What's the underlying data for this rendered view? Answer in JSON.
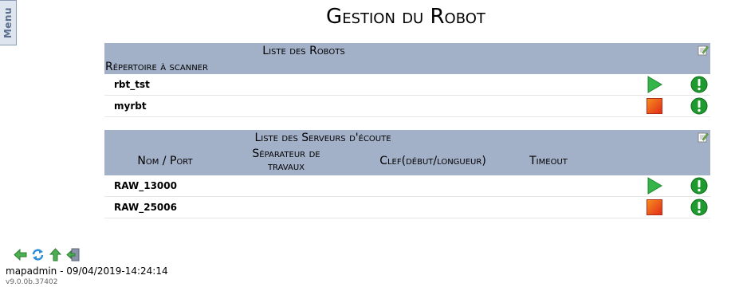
{
  "menu": {
    "label": "Menu"
  },
  "page": {
    "title": "Gestion du Robot"
  },
  "robots_panel": {
    "title": "Liste des Robots",
    "subtitle": "Répertoire à scanner",
    "rows": [
      {
        "name": "rbt_tst",
        "status": "stopped",
        "action_icon": "play-icon"
      },
      {
        "name": "myrbt",
        "status": "running",
        "action_icon": "stop-icon"
      }
    ]
  },
  "servers_panel": {
    "title": "Liste des Serveurs d'écoute",
    "columns": {
      "name_port": "Nom / Port",
      "separator": "Séparateur de travaux",
      "key": "Clef(début/longueur)",
      "timeout": "Timeout"
    },
    "rows": [
      {
        "name": "RAW_13000",
        "status": "stopped",
        "action_icon": "play-icon"
      },
      {
        "name": "RAW_25006",
        "status": "running",
        "action_icon": "stop-icon"
      }
    ]
  },
  "footer": {
    "user_line": "mapadmin - 09/04/2019-14:24:14",
    "version": "v9.0.0b.37402",
    "icons": [
      "back-icon",
      "refresh-icon",
      "up-icon",
      "logout-icon"
    ]
  },
  "colors": {
    "panel_header": "#a2b0c8",
    "play_green": "#35b44a",
    "stop_red": "#e8431c",
    "info_green": "#1e9a2e"
  }
}
